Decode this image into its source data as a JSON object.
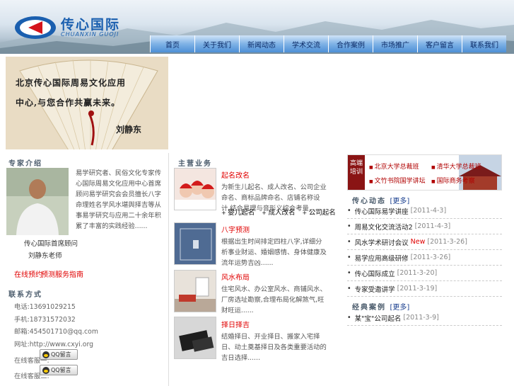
{
  "header": {
    "logo_cn": "传心国际",
    "logo_en": "CHUANXIN GUOJI",
    "nav": [
      "首页",
      "关于我们",
      "新闻动态",
      "学术交流",
      "合作案例",
      "市场推广",
      "客户留言",
      "联系我们"
    ]
  },
  "banner": {
    "line1": "北京传心国际周易文化应用",
    "line2": "中心,与您合作共赢未来。",
    "sign": "刘静东"
  },
  "expert": {
    "title": "专家介绍",
    "text": "易学研究者、民俗文化专家传心国际周易文化应用中心首席顾问易学研究会会员擅长八字命理姓名学风水堪舆择吉等从事易学研究与应用二十余年积累了丰富的实践经验......",
    "caption1": "传心国际首席顾问",
    "caption2": "刘静东老师",
    "link1": "在线预约",
    "link2": "预测服务指南"
  },
  "contact": {
    "title": "联系方式",
    "phone1_label": "电话:",
    "phone1": "13691029215",
    "phone2_label": "手机:",
    "phone2": "18731572032",
    "email_label": "邮箱:",
    "email": "454501710@qq.com",
    "web_label": "网址:",
    "web": "http://www.cxyi.org",
    "qq1_label": "在线客服一:",
    "qq2_label": "在线客服二:",
    "qq_btn": "QQ留言"
  },
  "business": {
    "title": "主营业务",
    "items": [
      {
        "title": "起名改名",
        "text": "为新生儿起名、成人改名、公司企业命名、商标品牌命名、店铺名称设计,结合易理与音形义综合考量......"
      },
      {
        "title": "八字预测",
        "text": "根据出生时间排定四柱八字,详细分析事业财运、婚姻感情、身体健康及流年运势吉凶......"
      },
      {
        "title": "风水布局",
        "text": "住宅风水、办公室风水、商铺风水、厂房选址勘察,合理布局化解煞气,旺财旺运......"
      },
      {
        "title": "择日择吉",
        "text": "结婚择日、开业择日、搬家入宅择日、动土奠基择日及各类重要活动的吉日选择......"
      }
    ],
    "sub_links": [
      "婴儿起名",
      "成人改名",
      "公司起名"
    ]
  },
  "right": {
    "tag": "高端培训",
    "banner_items": [
      "北京大学总裁班",
      "清华大学总裁班",
      "文竹书院国学讲坛",
      "国际商务考察"
    ],
    "news_title": "传心动态",
    "more": "更多",
    "news": [
      {
        "title": "传心国际易学讲座",
        "date": "[2011-4-3]",
        "new": ""
      },
      {
        "title": "周易文化交流活动2",
        "date": "[2011-4-3]",
        "new": ""
      },
      {
        "title": "风水学术研讨会议",
        "date": "[2011-3-26]",
        "new": "New"
      },
      {
        "title": "易学应用高级研修",
        "date": "[2011-3-26]",
        "new": ""
      },
      {
        "title": "传心国际成立",
        "date": "[2011-3-20]",
        "new": ""
      },
      {
        "title": "专家受邀讲学",
        "date": "[2011-3-19]",
        "new": ""
      }
    ],
    "cases_title": "经典案例",
    "cases": [
      {
        "title": "某\"宝\"公司起名",
        "date": "[2011-3-9]"
      }
    ]
  }
}
